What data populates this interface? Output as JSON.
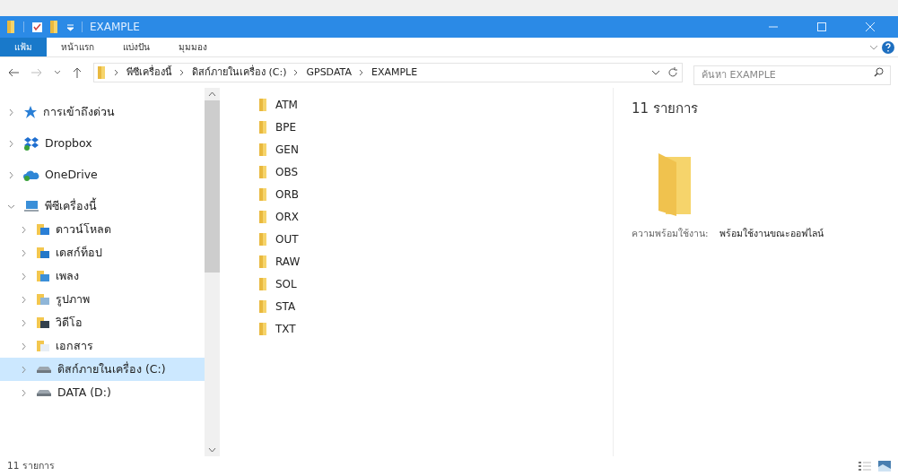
{
  "window": {
    "title": "EXAMPLE"
  },
  "ribbon_tabs": [
    {
      "label": "แฟ้ม",
      "selected": true
    },
    {
      "label": "หน้าแรก",
      "selected": false
    },
    {
      "label": "แบ่งปัน",
      "selected": false
    },
    {
      "label": "มุมมอง",
      "selected": false
    }
  ],
  "address": {
    "path": [
      "พีซีเครื่องนี้",
      "ดิสก์ภายในเครื่อง (C:)",
      "GPSDATA",
      "EXAMPLE"
    ]
  },
  "search": {
    "placeholder": "ค้นหา EXAMPLE"
  },
  "nav": [
    {
      "label": "การเข้าถึงด่วน",
      "kind": "star",
      "expanded": false,
      "selected": false
    },
    {
      "label": "Dropbox",
      "kind": "dropbox",
      "expanded": false,
      "selected": false
    },
    {
      "label": "OneDrive",
      "kind": "cloud",
      "expanded": false,
      "selected": false
    },
    {
      "label": "พีซีเครื่องนี้",
      "kind": "pc",
      "expanded": true,
      "selected": false,
      "children": [
        {
          "label": "ดาวน์โหลด",
          "kind": "download",
          "expanded": false,
          "selected": false
        },
        {
          "label": "เดสก์ท็อป",
          "kind": "desktop",
          "expanded": false,
          "selected": false
        },
        {
          "label": "เพลง",
          "kind": "music",
          "expanded": false,
          "selected": false
        },
        {
          "label": "รูปภาพ",
          "kind": "pictures",
          "expanded": false,
          "selected": false
        },
        {
          "label": "วิดีโอ",
          "kind": "video",
          "expanded": false,
          "selected": false
        },
        {
          "label": "เอกสาร",
          "kind": "documents",
          "expanded": false,
          "selected": false
        },
        {
          "label": "ดิสก์ภายในเครื่อง (C:)",
          "kind": "drive",
          "expanded": false,
          "selected": true
        },
        {
          "label": "DATA (D:)",
          "kind": "drive",
          "expanded": false,
          "selected": false
        }
      ]
    }
  ],
  "files": [
    "ATM",
    "BPE",
    "GEN",
    "OBS",
    "ORB",
    "ORX",
    "OUT",
    "RAW",
    "SOL",
    "STA",
    "TXT"
  ],
  "details": {
    "count": "11 รายการ",
    "availability_label": "ความพร้อมใช้งาน:",
    "availability_value": "พร้อมใช้งานขณะออฟไลน์"
  },
  "status_bar": {
    "count": "11 รายการ"
  }
}
